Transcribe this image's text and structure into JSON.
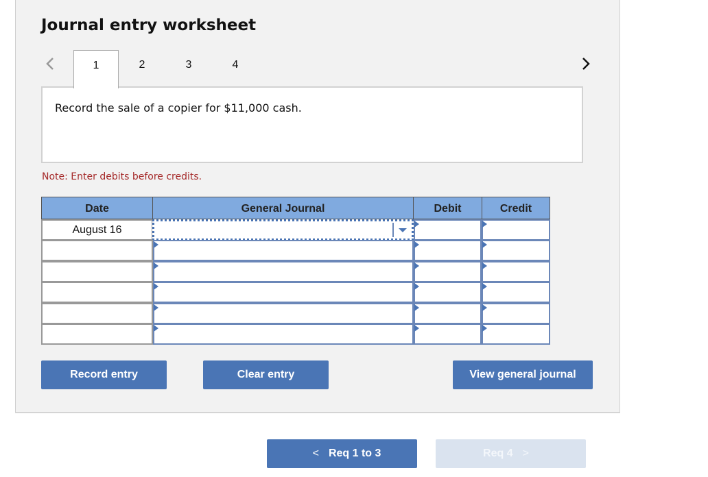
{
  "worksheet": {
    "title": "Journal entry worksheet",
    "tabs": [
      {
        "label": "1",
        "active": true
      },
      {
        "label": "2",
        "active": false
      },
      {
        "label": "3",
        "active": false
      },
      {
        "label": "4",
        "active": false
      }
    ],
    "prev_icon": "chevron-left-icon",
    "next_icon": "chevron-right-icon",
    "question": "Record the sale of a copier for $11,000 cash.",
    "note": "Note: Enter debits before credits."
  },
  "journal": {
    "headers": {
      "date": "Date",
      "general_journal": "General Journal",
      "debit": "Debit",
      "credit": "Credit"
    },
    "rows": [
      {
        "date": "August 16",
        "account": "",
        "debit": "",
        "credit": ""
      },
      {
        "date": "",
        "account": "",
        "debit": "",
        "credit": ""
      },
      {
        "date": "",
        "account": "",
        "debit": "",
        "credit": ""
      },
      {
        "date": "",
        "account": "",
        "debit": "",
        "credit": ""
      },
      {
        "date": "",
        "account": "",
        "debit": "",
        "credit": ""
      },
      {
        "date": "",
        "account": "",
        "debit": "",
        "credit": ""
      }
    ]
  },
  "actions": {
    "record_entry": "Record entry",
    "clear_entry": "Clear entry",
    "view_general_journal": "View general journal"
  },
  "footer_nav": {
    "prev_label": "Req 1 to 3",
    "prev_chevron": "<",
    "next_label": "Req 4",
    "next_chevron": ">",
    "next_disabled": true
  },
  "colors": {
    "accent": "#4a75b5",
    "header_bg": "#80aadf",
    "note": "#a52a2a",
    "panel_bg": "#f2f2f2",
    "disabled_btn": "#dae3ef"
  }
}
